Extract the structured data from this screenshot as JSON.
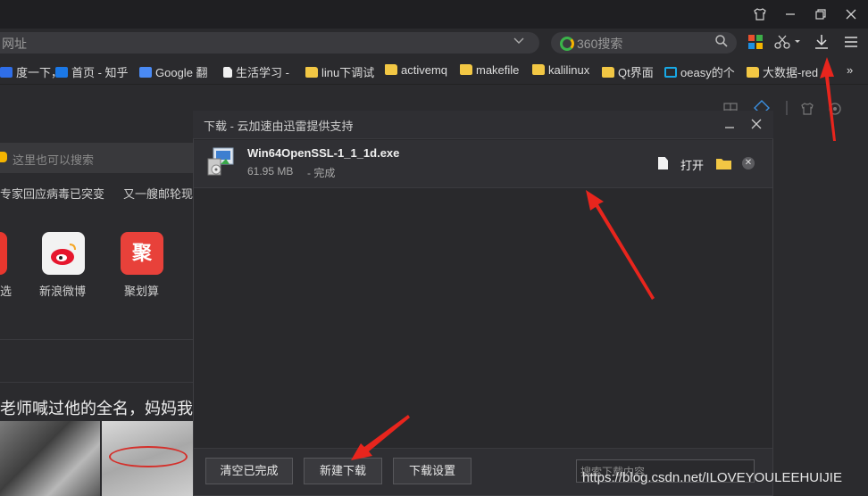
{
  "browser": {
    "url_placeholder": "网址",
    "search_engine": "360搜索"
  },
  "bookmarks": [
    {
      "label": "度一下，",
      "icon": "paw-icon"
    },
    {
      "label": "首页 - 知乎",
      "icon": "zhihu-icon"
    },
    {
      "label": "Google 翻",
      "icon": "google-translate-icon"
    },
    {
      "label": "生活学习 -",
      "icon": "document-icon"
    },
    {
      "label": "linu下调试",
      "icon": "folder-icon"
    },
    {
      "label": "activemq",
      "icon": "folder-icon"
    },
    {
      "label": "makefile",
      "icon": "folder-icon"
    },
    {
      "label": "kalilinux",
      "icon": "folder-icon"
    },
    {
      "label": "Qt界面",
      "icon": "folder-icon"
    },
    {
      "label": "oeasy的个",
      "icon": "bilibili-icon"
    },
    {
      "label": "大数据-red",
      "icon": "folder-icon"
    },
    {
      "label": "»",
      "icon": ""
    }
  ],
  "background_page": {
    "search_placeholder": "这里也可以搜索",
    "news_1": "专家回应病毒已突变",
    "news_2": "又一艘邮轮现",
    "app_1_label": "选",
    "app_2_label": "新浪微博",
    "app_3_label": "聚划算",
    "app_3_glyph": "聚",
    "headline": "老师喊过他的全名，妈妈我"
  },
  "dialog": {
    "title": "下载 - 云加速由迅雷提供支持",
    "item": {
      "filename": "Win64OpenSSL-1_1_1d.exe",
      "size": "61.95 MB",
      "status": "- 完成",
      "open_label": "打开"
    },
    "buttons": {
      "clear": "清空已完成",
      "new": "新建下载",
      "settings": "下载设置"
    },
    "find_placeholder": "搜索下载内容"
  },
  "watermark": "https://blog.csdn.net/ILOVEYOULEEHUIJIE",
  "colors": {
    "annotation_arrow": "#e8251d",
    "chrome_bg": "#1f1f22",
    "dialog_bg": "#29292c",
    "folder": "#f2c744"
  }
}
